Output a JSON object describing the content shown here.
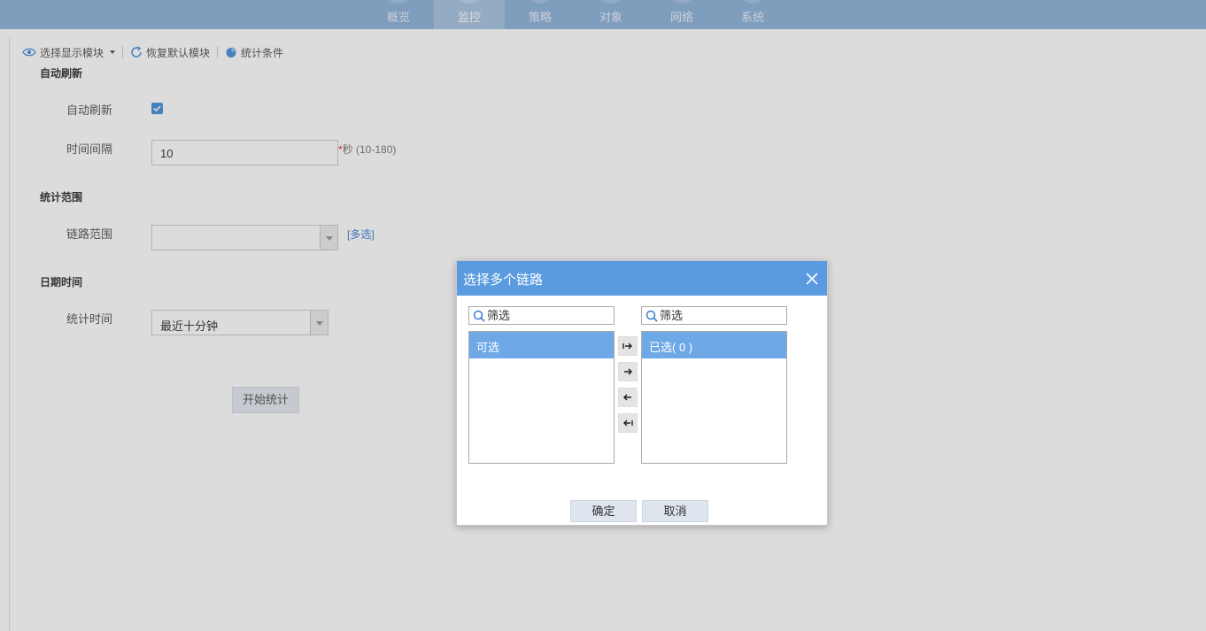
{
  "topnav": {
    "tabs": [
      {
        "label": "概览",
        "active": false
      },
      {
        "label": "监控",
        "active": true
      },
      {
        "label": "策略",
        "active": false
      },
      {
        "label": "对象",
        "active": false
      },
      {
        "label": "网络",
        "active": false
      },
      {
        "label": "系统",
        "active": false
      }
    ]
  },
  "toolbar": {
    "select_modules": "选择显示模块",
    "restore_default": "恢复默认模块",
    "stat_conditions": "统计条件"
  },
  "form": {
    "auto_refresh": {
      "section_title": "自动刷新",
      "checkbox_label": "自动刷新",
      "checked": true,
      "interval_label": "时间间隔",
      "interval_value": "10",
      "required_star": "*",
      "interval_note": "秒  (10-180)"
    },
    "stat_range": {
      "section_title": "统计范围",
      "link_range_label": "链路范围",
      "link_range_value": "",
      "multi_select_link": "[多选]"
    },
    "datetime": {
      "section_title": "日期时间",
      "stat_time_label": "统计时间",
      "stat_time_value": "最近十分钟"
    },
    "start_button": "开始统计"
  },
  "dialog": {
    "title": "选择多个链路",
    "left_filter_placeholder": "筛选",
    "right_filter_placeholder": "筛选",
    "available_header": "可选",
    "selected_header": "已选( 0 )",
    "confirm": "确定",
    "cancel": "取消"
  },
  "colors": {
    "nav_bg": "#8eb2d9",
    "dialog_header": "#5a9ae0",
    "list_header": "#6fa8e6",
    "checkbox": "#4a90d9",
    "link": "#3a7fd0"
  }
}
